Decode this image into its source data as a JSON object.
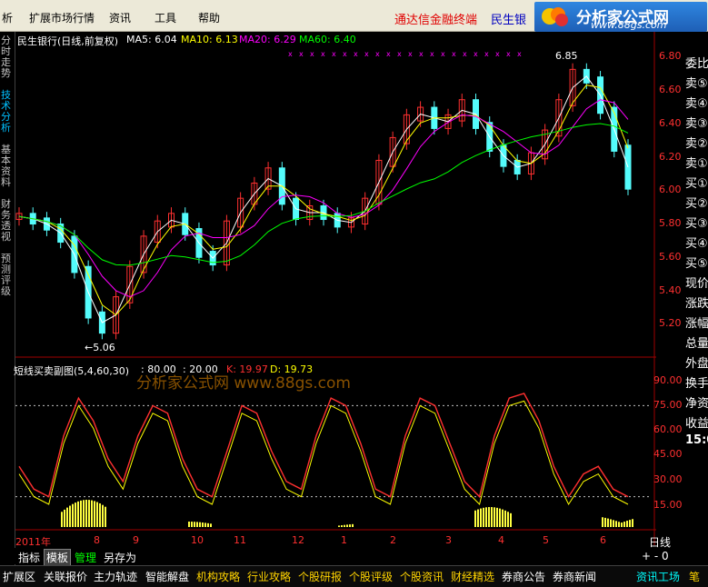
{
  "menu": [
    "析",
    "扩展市场行情",
    "资讯",
    "工具",
    "帮助"
  ],
  "promo": "通达信金融终端",
  "promo_stock": "民生银",
  "logo": {
    "title": "分析家公式网",
    "url": "www.88gs.com"
  },
  "left_tabs": [
    {
      "label": "分时走势",
      "active": false
    },
    {
      "label": "技术分析",
      "active": true
    },
    {
      "label": "基本资料",
      "active": false
    },
    {
      "label": "财务透视",
      "active": false
    },
    {
      "label": "预测评级",
      "active": false
    }
  ],
  "price_header": {
    "stock": "民生银行(日线,前复权)",
    "ma5": "MA5: 6.04",
    "ma10": "MA10: 6.13",
    "ma20": "MA20: 6.29",
    "ma60": "MA60: 6.40"
  },
  "high_label": "6.85",
  "low_label": "←5.06",
  "price_ticks": [
    "6.80",
    "6.60",
    "6.40",
    "6.20",
    "6.00",
    "5.80",
    "5.60",
    "5.40",
    "5.20"
  ],
  "indicator_header": {
    "name": "短线买卖副图(5,4,60,30)",
    "v1": ": 80.00",
    "v2": ": 20.00",
    "k": "K: 19.97",
    "d": "D: 19.73"
  },
  "watermark": "分析家公式网 www.88gs.com",
  "ind_ticks": [
    "90.00",
    "75.00",
    "60.00",
    "45.00",
    "30.00",
    "15.00"
  ],
  "months": [
    "2011年",
    "8",
    "9",
    "10",
    "11",
    "12",
    "1",
    "2",
    "3",
    "4",
    "5",
    "6"
  ],
  "right_panel": [
    "委比",
    "卖⑤",
    "卖④",
    "卖③",
    "卖②",
    "卖①",
    "买①",
    "买②",
    "买③",
    "买④",
    "买⑤",
    "现价",
    "涨跌",
    "涨幅",
    "总量",
    "外盘",
    "换手",
    "净资",
    "收益",
    "15:0"
  ],
  "day_tab": "日线",
  "pm": "+ - 0",
  "bottom_tabs": [
    {
      "label": "指标",
      "sel": false,
      "green": false
    },
    {
      "label": "模板",
      "sel": true,
      "green": false
    },
    {
      "label": "管理",
      "sel": false,
      "green": true
    },
    {
      "label": "另存为",
      "sel": false,
      "green": false
    }
  ],
  "footer": [
    {
      "label": "扩展区",
      "color": "white"
    },
    {
      "label": "关联报价",
      "color": "white"
    },
    {
      "label": "主力轨迹",
      "color": "white"
    },
    {
      "label": "智能解盘",
      "color": "white"
    },
    {
      "label": "机构攻略",
      "color": "yellow"
    },
    {
      "label": "行业攻略",
      "color": "yellow"
    },
    {
      "label": "个股研报",
      "color": "yellow"
    },
    {
      "label": "个股评级",
      "color": "yellow"
    },
    {
      "label": "个股资讯",
      "color": "yellow"
    },
    {
      "label": "财经精选",
      "color": "yellow"
    },
    {
      "label": "券商公告",
      "color": "white"
    },
    {
      "label": "券商新闻",
      "color": "white"
    },
    {
      "label": "资讯工场",
      "color": "cyan"
    },
    {
      "label": "笔",
      "color": "yellow"
    }
  ],
  "colors": {
    "up": "#ff3030",
    "down": "#54fcfc",
    "ma5": "#ffffff",
    "ma10": "#ffff00",
    "ma20": "#ff00ff",
    "ma60": "#00ff00"
  },
  "chart_data": [
    {
      "type": "candlestick",
      "title": "民生银行(日线,前复权)",
      "ylim": [
        5.0,
        6.9
      ],
      "high": 6.85,
      "low": 5.06,
      "series": [
        {
          "name": "MA5",
          "values": [
            6.04
          ]
        },
        {
          "name": "MA10",
          "values": [
            6.13
          ]
        },
        {
          "name": "MA20",
          "values": [
            6.29
          ]
        },
        {
          "name": "MA60",
          "values": [
            6.4
          ]
        }
      ]
    },
    {
      "type": "line",
      "title": "短线买卖副图(5,4,60,30)",
      "ylim": [
        0,
        100
      ],
      "series": [
        {
          "name": "K",
          "values": [
            19.97
          ]
        },
        {
          "name": "D",
          "values": [
            19.73
          ]
        }
      ],
      "reference_lines": [
        80,
        20
      ]
    }
  ]
}
